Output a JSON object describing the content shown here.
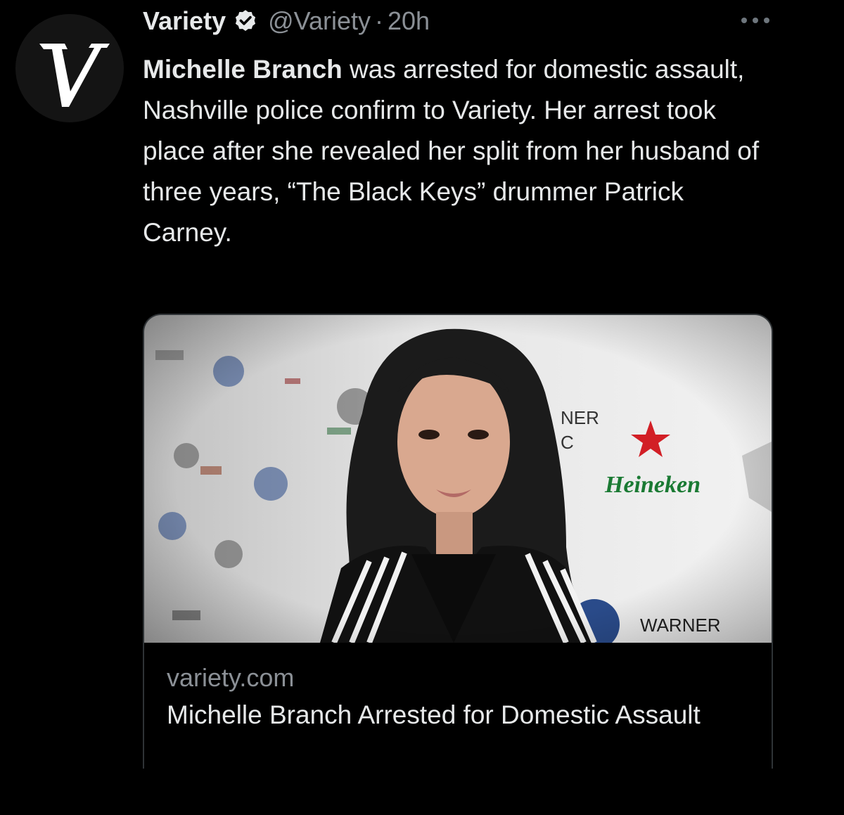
{
  "tweet": {
    "author": {
      "name": "Variety",
      "handle": "@Variety",
      "separator": "·",
      "time": "20h",
      "avatar_icon": "variety-v-logo",
      "verified_icon": "verified-badge-icon"
    },
    "more_icon": "more-horizontal-icon",
    "text": {
      "bold_lead": "Michelle Branch",
      "rest": " was arrested for domestic assault, Nashville police confirm to Variety. Her arrest took place after she revealed her split from her husband of three years, “The Black Keys” drummer Patrick Carney."
    },
    "link_card": {
      "image_description_icon": "article-photo",
      "backdrop_logos": [
        "Heineken",
        "WARNER",
        "NER"
      ],
      "domain": "variety.com",
      "title": "Michelle Branch Arrested for Domestic Assault"
    }
  },
  "colors": {
    "background": "#000000",
    "primary_text": "#e7e9ea",
    "secondary_text": "#8b9096",
    "card_border": "#2f3336",
    "heineken_green": "#1a7a33",
    "heineken_red": "#d21f26"
  }
}
